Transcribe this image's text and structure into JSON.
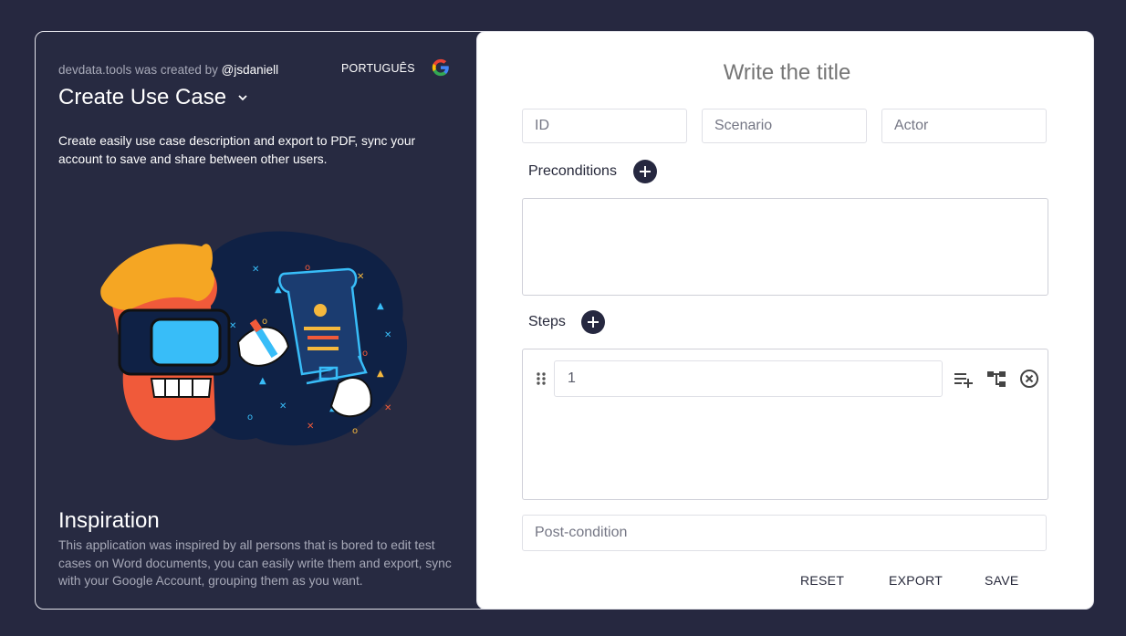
{
  "header": {
    "credit_prefix": "devdata.tools was created by ",
    "credit_handle": "@jsdaniell",
    "language_label": "PORTUGUÊS",
    "google_icon": "google-icon",
    "menu_title": "Create Use Case"
  },
  "intro": {
    "description": "Create easily use case description and export to PDF, sync your account to save and share between other users."
  },
  "inspiration": {
    "title": "Inspiration",
    "text": "This application was inspired by all persons that is bored to edit test cases on Word documents, you can easily write them and export, sync with your Google Account, grouping them as you want."
  },
  "form": {
    "title_placeholder": "Write the title",
    "id_placeholder": "ID",
    "scenario_placeholder": "Scenario",
    "actor_placeholder": "Actor",
    "preconditions_label": "Preconditions",
    "steps_label": "Steps",
    "steps": [
      {
        "value": "1"
      }
    ],
    "postcondition_placeholder": "Post-condition"
  },
  "actions": {
    "reset": "RESET",
    "export": "EXPORT",
    "save": "SAVE"
  },
  "colors": {
    "background": "#262840",
    "panel": "#272a41",
    "accent": "#262840",
    "muted_text": "#a7a9b8"
  }
}
